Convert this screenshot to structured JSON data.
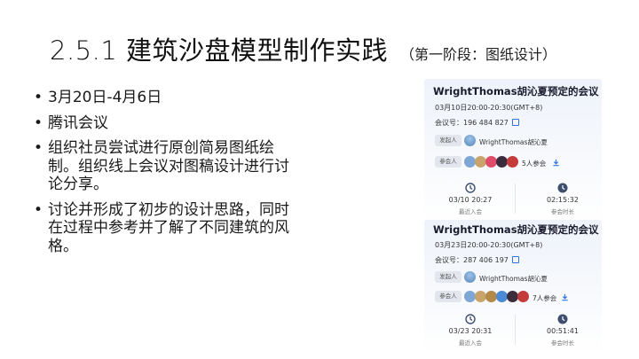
{
  "slide": {
    "title": "2.5.1 建筑沙盘模型制作实践",
    "subtitle": "（第一阶段：图纸设计）",
    "bullets": [
      "3月20日-4月6日",
      "腾讯会议",
      "组织社员尝试进行原创简易图纸绘制。组织线上会议对图稿设计进行讨论分享。",
      "讨论并形成了初步的设计思路，同时在过程中参考并了解了不同建筑的风格。"
    ]
  },
  "meetings": [
    {
      "title": "WrightThomas胡沁夏预定的会议",
      "time": "03月10日20:00-20:30(GMT+8)",
      "meeting_id": "会议号：196 484 827",
      "host_label": "发起人",
      "host_name": "WrightThomas胡沁夏",
      "participants_label": "参会人",
      "participants_count": "5人参会",
      "join_time": "03/10 20:27",
      "join_label": "最近入会",
      "duration": "02:15:32",
      "duration_label": "参会时长"
    },
    {
      "title": "WrightThomas胡沁夏预定的会议",
      "time": "03月23日20:00-20:30(GMT+8)",
      "meeting_id": "会议号：287 406 197",
      "host_label": "发起人",
      "host_name": "WrightThomas胡沁夏",
      "participants_label": "参会人",
      "participants_count": "7人参会",
      "join_time": "03/23 20:31",
      "join_label": "最近入会",
      "duration": "00:51:41",
      "duration_label": "参会时长"
    }
  ],
  "colors": {
    "accent": "#2f73e6",
    "card_bg": "#eef3fb"
  }
}
